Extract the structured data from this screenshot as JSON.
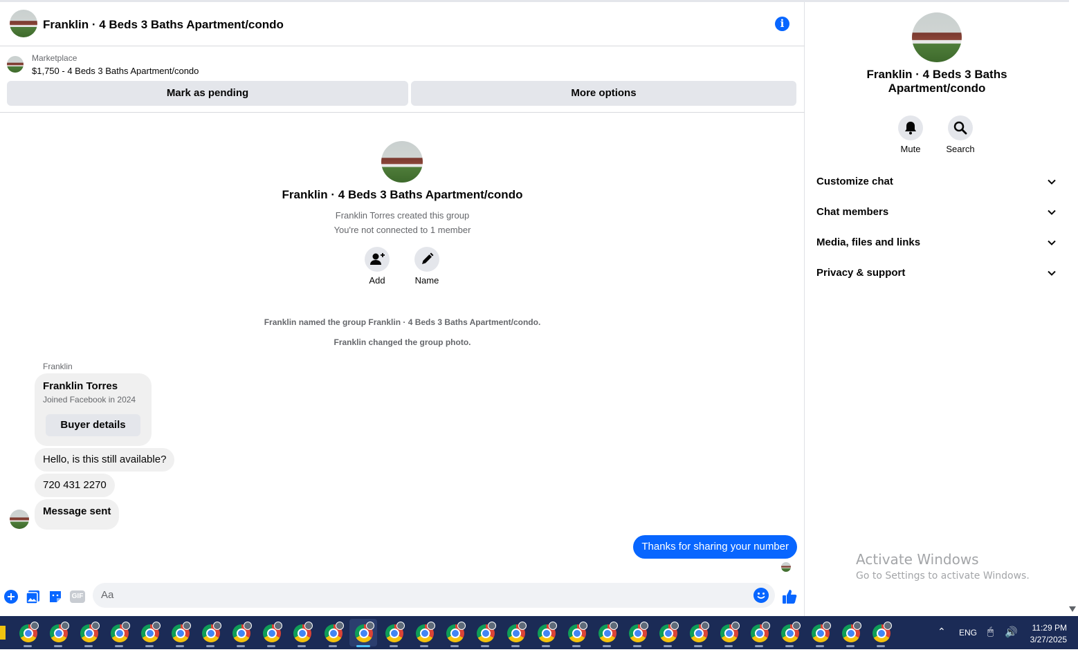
{
  "header": {
    "title": "Franklin · 4 Beds 3 Baths Apartment/condo",
    "info_icon": "info-icon"
  },
  "marketplace": {
    "label": "Marketplace",
    "listing": "$1,750 - 4 Beds 3 Baths Apartment/condo",
    "mark_pending_label": "Mark as pending",
    "more_options_label": "More options"
  },
  "group_intro": {
    "title": "Franklin · 4 Beds 3 Baths Apartment/condo",
    "created": "Franklin Torres created this group",
    "not_connected": "You're not connected to 1 member",
    "add_label": "Add",
    "name_label": "Name"
  },
  "system_messages": [
    "Franklin named the group Franklin · 4 Beds 3 Baths Apartment/condo.",
    "Franklin changed the group photo."
  ],
  "thread": {
    "sender": "Franklin",
    "card": {
      "name": "Franklin Torres",
      "joined": "Joined Facebook in 2024",
      "button": "Buyer details"
    },
    "incoming": [
      "Hello, is this still available?",
      "720 431 2270",
      "Message sent"
    ],
    "outgoing": "Thanks for sharing your number"
  },
  "composer": {
    "placeholder": "Aa",
    "icons": [
      "plus-icon",
      "photo-icon",
      "sticker-icon",
      "gif-icon",
      "emoji-icon",
      "thumbs-up-icon"
    ],
    "gif_text": "GIF"
  },
  "sidebar": {
    "title": "Franklin · 4 Beds 3 Baths Apartment/condo",
    "mute_label": "Mute",
    "search_label": "Search",
    "sections": [
      "Customize chat",
      "Chat members",
      "Media, files and links",
      "Privacy & support"
    ]
  },
  "watermark": {
    "line1": "Activate Windows",
    "line2": "Go to Settings to activate Windows."
  },
  "taskbar": {
    "app_count": 29,
    "active_index": 11,
    "language": "ENG",
    "time": "11:29 PM",
    "date": "3/27/2025"
  },
  "colors": {
    "accent": "#0866ff",
    "bubble_in": "#f0f0f0",
    "button_grey": "#e4e6eb",
    "taskbar": "#1b2b56"
  }
}
